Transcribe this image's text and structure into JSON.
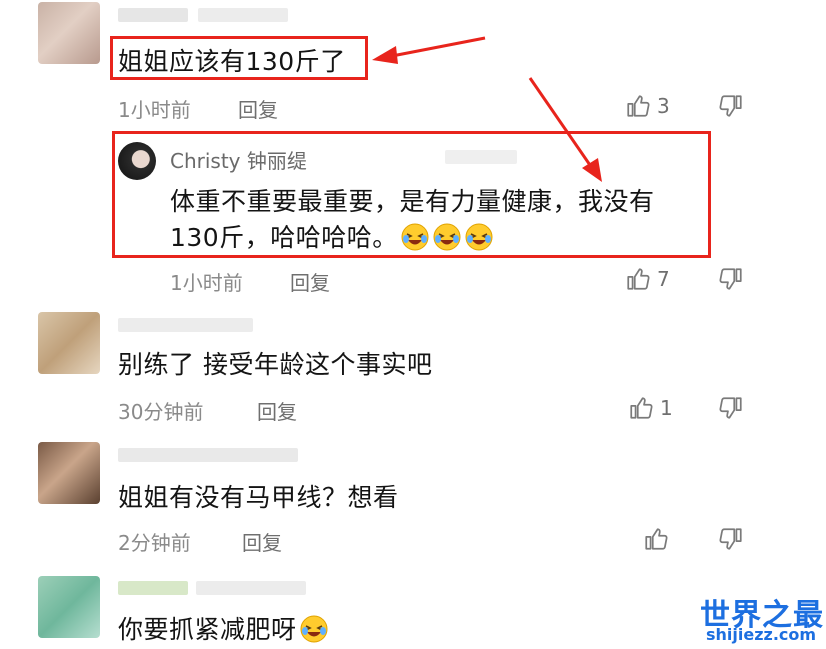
{
  "comments": [
    {
      "text": "姐姐应该有130斤了",
      "time": "1小时前",
      "reply_label": "回复",
      "likes": "3"
    },
    {
      "text": "别练了 接受年龄这个事实吧",
      "time": "30分钟前",
      "reply_label": "回复",
      "likes": "1"
    },
    {
      "text": "姐姐有没有马甲线？想看",
      "time": "2分钟前",
      "reply_label": "回复",
      "likes": ""
    },
    {
      "text": "你要抓紧减肥呀",
      "time": "",
      "reply_label": "",
      "likes": "",
      "emoji": "laughing-crying-emoji"
    }
  ],
  "reply": {
    "author": "Christy 钟丽缇",
    "text_line1": "体重不重要最重要，是有力量健康，我没有",
    "text_line2": "130斤，哈哈哈哈。",
    "emoji": "laughing-crying-emoji",
    "emoji_count": 3,
    "time": "1小时前",
    "reply_label": "回复",
    "likes": "7"
  },
  "watermark": {
    "title": "世界之最",
    "url": "shijiezz.com"
  },
  "colors": {
    "highlight": "#e8241c",
    "muted_text": "#8a8a8a",
    "watermark": "#1d6fe0"
  },
  "icons": [
    "thumbs-up-icon",
    "thumbs-down-icon",
    "red-arrow-icon"
  ]
}
